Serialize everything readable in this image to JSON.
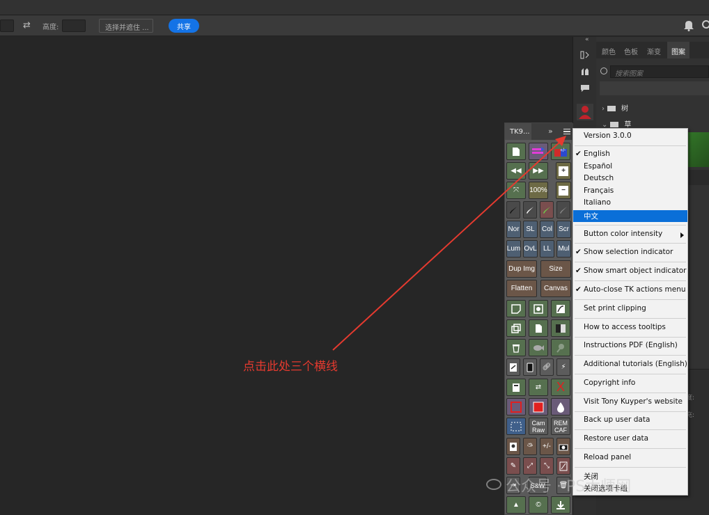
{
  "optbar": {
    "height_label": "高度:",
    "select_mask": "选择并遮住 ...",
    "share": "共享"
  },
  "panel": {
    "tabs": [
      "颜色",
      "色板",
      "渐变",
      "图案"
    ],
    "search_placeholder": "搜索图案",
    "folders": [
      "树",
      "草"
    ],
    "lower_labels": [
      "度:",
      "充:"
    ]
  },
  "tk": {
    "tab": "TK9...",
    "buttons": [
      "100%",
      "Nor",
      "SL",
      "Col",
      "Scr",
      "Lum",
      "OvL",
      "LL",
      "Mul",
      "Dup Img",
      "Size",
      "Flatten",
      "Canvas",
      "Cam Raw",
      "REM CAF",
      "+/-",
      "S&W"
    ]
  },
  "menu": {
    "version": "Version 3.0.0",
    "languages": [
      "English",
      "Español",
      "Deutsch",
      "Français",
      "Italiano",
      "中文"
    ],
    "items": [
      "Button color intensity",
      "Show selection indicator",
      "Show smart object indicator",
      "Auto-close TK actions menu",
      "Set print clipping",
      "How to access tooltips",
      "Instructions PDF (English)",
      "Additional tutorials (English)",
      "Copyright info",
      "Visit Tony Kuyper's website",
      "Back up user data",
      "Restore user data",
      "Reload panel"
    ],
    "close": "关闭",
    "close_tab_group": "关闭选项卡组"
  },
  "annotation": "点击此处三个横线",
  "watermark": "公众号 · PS大师网",
  "colors": {
    "accent": "#1473e6",
    "annotation": "#e53a2f",
    "selection": "#0a6fd8"
  }
}
